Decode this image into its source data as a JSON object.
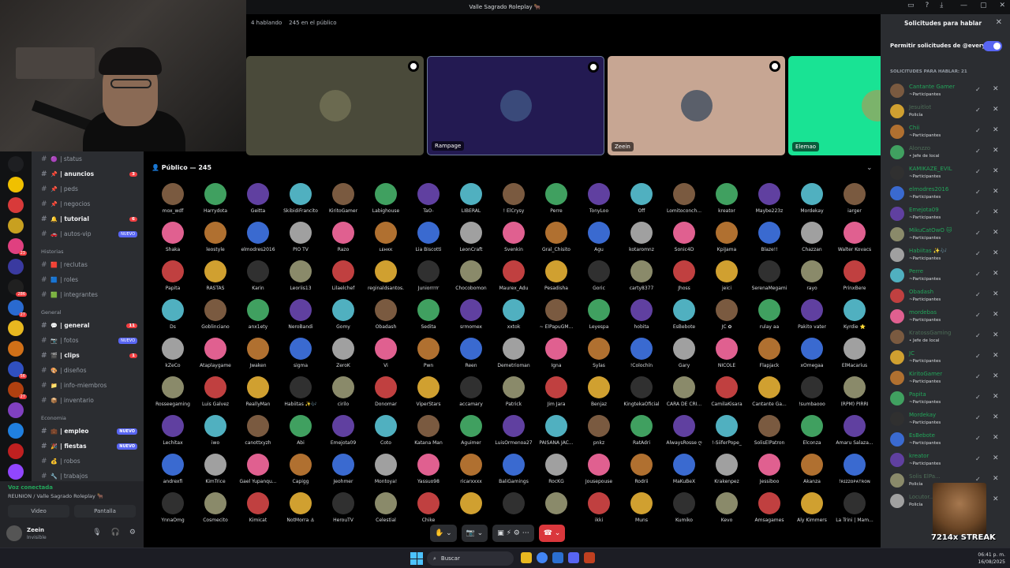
{
  "window": {
    "title": "Valle Sagrado Roleplay 🐂"
  },
  "stage": {
    "speaking": "4 hablando",
    "audience": "245 en el público",
    "public_header": "Público — 245"
  },
  "speakers": [
    {
      "name": "",
      "bg": "#4a4a3a",
      "av": "#6b6a50"
    },
    {
      "name": "Rampage",
      "bg": "#231a52",
      "av": "#3a4a7a"
    },
    {
      "name": "Zeein",
      "bg": "#c7a693",
      "av": "#5a5f6a"
    },
    {
      "name": "Elemao",
      "bg": "#19e394",
      "av": "#7bb36b"
    }
  ],
  "audience": [
    [
      "mox_wdf",
      "Harrydota",
      "Geitta",
      "SkibidiFrancito",
      "KiritoGamer",
      "Labighouse",
      "TaO-",
      "LIBERAL",
      "! ElCrysy",
      "Perre",
      "TonyLoo",
      "Off",
      "Lomitoconch...",
      "kreator",
      "Maybe223z",
      "Mordekay",
      "iarger"
    ],
    [
      "Shaka",
      "leostyle",
      "elmodres2016",
      "PIO TV",
      "Razo",
      "ʟᴇʜᴋᴋ",
      "Lia Biscotti",
      "LeonCraft",
      "Svenkin",
      "Gral_Chisito",
      "Agu",
      "kotaromnz",
      "Sonic4D",
      "KpiJama",
      "Blaze!!",
      "Chazzan",
      "Walter Kovacs"
    ],
    [
      "Papita",
      "RASTAS",
      "Karin",
      "Leoriis13",
      "Lilaelchef",
      "reginaldsantos.",
      "Juniorrrrr",
      "Chocobomon",
      "Maurex_Adu",
      "Pesadisha",
      "Goric",
      "carty8377",
      "Jhoss",
      "jeici",
      "SerenaMegami",
      "rayo",
      "PrinxBere"
    ],
    [
      "Ds",
      "Goblinciano",
      "anx1ety",
      "NeroBandi",
      "Gomy",
      "Obadash",
      "Sedita",
      "srmomex",
      "xxtok",
      "~ ElPapuGM...",
      "Leyespa",
      "hobita",
      "EsBebote",
      "JC ✿",
      "rulay aa",
      "Pakito vater",
      "Kyrdie ⭐"
    ],
    [
      "kZeCo",
      "Ataplaygame",
      "Jwaken",
      "sigma",
      "ZeroK",
      "Vi",
      "Pwn",
      "Reen",
      "Demetrioman",
      "Igna",
      "Sylas",
      "!Colochín",
      "Gary",
      "NICOLE",
      "Flapjack",
      "xOmegaa",
      "ElMacarius"
    ],
    [
      "Rosseegaming",
      "Luis Galvez",
      "ReallyMan",
      "Habiitas ✨🎶",
      "cirilo",
      "Donomar",
      "ViperStars",
      "accamary",
      "Patrick",
      "Jim Jara",
      "Benjaz",
      "KingtekaOficial",
      "CARA DE CRI...",
      "CamilaKisara",
      "Cantante Ga...",
      "!sumbaooo",
      "(RPM) PIRRI"
    ],
    [
      "Lechitax",
      "iwo",
      "canottxyzh",
      "Abi",
      "Emejota09",
      "Coto",
      "Katana Man",
      "Aguimer",
      "LuisOrmenoa27",
      "PAISANA JAC...",
      "pnkz",
      "RatAdri",
      "AlwaysRosse ღ",
      "!-SiiferPope_",
      "SolisElPatron",
      "Elconza",
      "Amaru Salaza..."
    ],
    [
      "andrexfi",
      "KimTrice",
      "Gael Yupanqu...",
      "Capigg",
      "Jeohmer",
      "Montoya!",
      "Yassuo98",
      "ricarxxxx",
      "BaliGamings",
      "RocKG",
      "Jousepouse",
      "Rodrii",
      "MaKuBeX",
      "Krakenpez",
      "Jessiboo",
      "Akanza",
      "!ʀɪᴢᴢᴏᴘᴀᴛʀᴏɴ"
    ],
    [
      "YnnaOmg",
      "Cosmecito",
      "Kimicat",
      "NotMorra ⚓",
      "HerouTV",
      "Celestial",
      "Chike",
      "",
      "",
      "",
      "ikki",
      "Muns",
      "Kumiko",
      "Kevo",
      "Amsagames",
      "Aly Kimmers",
      "La Trini | Mam..."
    ]
  ],
  "servers": [
    {
      "color": "#1e1f22",
      "badge": ""
    },
    {
      "color": "#f0c000",
      "badge": ""
    },
    {
      "color": "#d83a3a",
      "badge": ""
    },
    {
      "color": "#c8a020",
      "badge": ""
    },
    {
      "color": "#e04080",
      "badge": "23"
    },
    {
      "color": "#3a3aa0",
      "badge": ""
    },
    {
      "color": "#202020",
      "badge": "286"
    },
    {
      "color": "#2a6ad0",
      "badge": "27"
    },
    {
      "color": "#e8b820",
      "badge": ""
    },
    {
      "color": "#d07018",
      "badge": ""
    },
    {
      "color": "#3050c0",
      "badge": "56"
    },
    {
      "color": "#b04010",
      "badge": "27"
    },
    {
      "color": "#8040c0",
      "badge": ""
    },
    {
      "color": "#2080e0",
      "badge": ""
    },
    {
      "color": "#c02020",
      "badge": ""
    },
    {
      "color": "#9146ff",
      "badge": ""
    }
  ],
  "nuevo_tag": "NUEVO",
  "channels": [
    {
      "type": "chan",
      "emo": "🟣",
      "label": "| status",
      "bright": false
    },
    {
      "type": "chan",
      "emo": "📌",
      "label": "| anuncios",
      "bright": true,
      "count": "3"
    },
    {
      "type": "chan",
      "emo": "📌",
      "label": "| peds",
      "bright": false
    },
    {
      "type": "chan",
      "emo": "📌",
      "label": "| negocios",
      "bright": false
    },
    {
      "type": "chan",
      "emo": "🔔",
      "label": "| tutorial",
      "bright": true,
      "count": "6"
    },
    {
      "type": "chan",
      "emo": "🚗",
      "label": "| autos-vip",
      "bright": false,
      "new": "NUEVO"
    },
    {
      "type": "cat",
      "label": "Historias"
    },
    {
      "type": "chan",
      "emo": "🟥",
      "label": "| reclutas",
      "bright": false
    },
    {
      "type": "chan",
      "emo": "🟦",
      "label": "| roles",
      "bright": false
    },
    {
      "type": "chan",
      "emo": "🟩",
      "label": "| integrantes",
      "bright": false
    },
    {
      "type": "cat",
      "label": "General"
    },
    {
      "type": "chan",
      "emo": "💬",
      "label": "| general",
      "bright": true,
      "count": "11"
    },
    {
      "type": "chan",
      "emo": "📷",
      "label": "| fotos",
      "bright": false,
      "new": "NUEVO"
    },
    {
      "type": "chan",
      "emo": "🎬",
      "label": "| clips",
      "bright": true,
      "count": "1"
    },
    {
      "type": "chan",
      "emo": "🎨",
      "label": "| diseños",
      "bright": false
    },
    {
      "type": "chan",
      "emo": "📁",
      "label": "| info-miembros",
      "bright": false
    },
    {
      "type": "chan",
      "emo": "📦",
      "label": "| inventario",
      "bright": false
    },
    {
      "type": "cat",
      "label": "Economia"
    },
    {
      "type": "chan",
      "emo": "💼",
      "label": "| empleo",
      "bright": true,
      "new": "NUEVO"
    },
    {
      "type": "chan",
      "emo": "🎉",
      "label": "| fiestas",
      "bright": true,
      "new": "NUEVO"
    },
    {
      "type": "chan",
      "emo": "💰",
      "label": "| robos",
      "bright": false
    },
    {
      "type": "chan",
      "emo": "🔧",
      "label": "| trabajos",
      "bright": false
    }
  ],
  "voice": {
    "status": "Voz conectada",
    "room": "REUNION / Valle Sagrado Roleplay 🐂",
    "video": "Video",
    "screen": "Pantalla"
  },
  "user": {
    "name": "Zeein",
    "status": "Invisible"
  },
  "requests": {
    "title": "Solicitudes para hablar",
    "allow": "Permitir solicitudes de @everyone",
    "header": "SOLICITUDES PARA HABLAR: 21",
    "items": [
      {
        "name": "Cantante Gamer",
        "role": "~Participantes",
        "dim": false
      },
      {
        "name": "Jesuitlot",
        "role": "Policía",
        "dim": true
      },
      {
        "name": "Chii",
        "role": "~Participantes",
        "dim": false
      },
      {
        "name": "Alonzzo",
        "role": "• Jefe de local",
        "dim": true
      },
      {
        "name": "KAMIKAZE_EVIL",
        "role": "~Participantes",
        "dim": false
      },
      {
        "name": "elmodres2016",
        "role": "~Participantes",
        "dim": false
      },
      {
        "name": "Emejota09",
        "role": "~Participantes",
        "dim": false
      },
      {
        "name": "MikuCatOwO 🐱",
        "role": "~Participantes",
        "dim": false
      },
      {
        "name": "Habiitas ✨🎶",
        "role": "~Participantes",
        "dim": false
      },
      {
        "name": "Perre",
        "role": "~Participantes",
        "dim": false
      },
      {
        "name": "Obadash",
        "role": "~Participantes",
        "dim": false
      },
      {
        "name": "mordebas",
        "role": "~Participantes",
        "dim": false
      },
      {
        "name": "KratossGaming",
        "role": "• Jefe de local",
        "dim": true
      },
      {
        "name": "JC",
        "role": "~Participantes",
        "dim": false
      },
      {
        "name": "KiritoGamer",
        "role": "~Participantes",
        "dim": false
      },
      {
        "name": "Papita",
        "role": "~Participantes",
        "dim": false
      },
      {
        "name": "Mordekay",
        "role": "~Participantes",
        "dim": false
      },
      {
        "name": "EsBebote",
        "role": "~Participantes",
        "dim": false
      },
      {
        "name": "kreator",
        "role": "~Participantes",
        "dim": false
      },
      {
        "name": "Solis ElPa...",
        "role": "Policía",
        "dim": true
      },
      {
        "name": "Locutor...",
        "role": "Policía",
        "dim": true
      }
    ]
  },
  "overlay": {
    "streak": "7214x STREAK"
  },
  "taskbar": {
    "search": "Buscar",
    "time": "06:41 p. m.",
    "date": "16/08/2025"
  },
  "colors": {
    "accent": "#5865f2",
    "online": "#23a55a",
    "danger": "#da373c"
  }
}
